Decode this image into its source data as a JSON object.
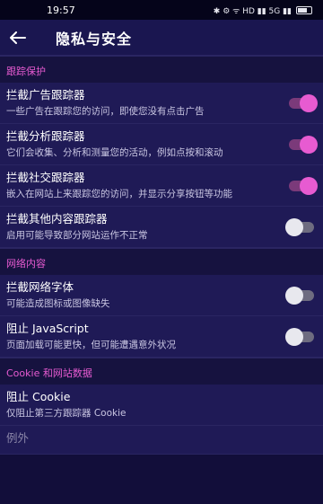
{
  "status": {
    "time": "19:57",
    "icons": "✱ ⚙ ᯤ HD ▮▮ 5G ▮▮"
  },
  "appbar": {
    "title": "隐私与安全"
  },
  "sections": [
    {
      "header": "跟踪保护",
      "rows": [
        {
          "title": "拦截广告跟踪器",
          "desc": "一些广告在跟踪您的访问，即使您没有点击广告",
          "on": true
        },
        {
          "title": "拦截分析跟踪器",
          "desc": "它们会收集、分析和测量您的活动，例如点按和滚动",
          "on": true
        },
        {
          "title": "拦截社交跟踪器",
          "desc": "嵌入在网站上来跟踪您的访问，并显示分享按钮等功能",
          "on": true
        },
        {
          "title": "拦截其他内容跟踪器",
          "desc": "启用可能导致部分网站运作不正常",
          "on": false
        }
      ]
    },
    {
      "header": "网络内容",
      "rows": [
        {
          "title": "拦截网络字体",
          "desc": "可能造成图标或图像缺失",
          "on": false
        },
        {
          "title": "阻止 JavaScript",
          "desc": "页面加载可能更快，但可能遭遇意外状况",
          "on": false
        }
      ]
    },
    {
      "header": "Cookie 和网站数据",
      "rows": [
        {
          "title": "阻止 Cookie",
          "desc": "仅阻止第三方跟踪器 Cookie",
          "on": null
        },
        {
          "title": "例外",
          "desc": "",
          "on": null
        }
      ]
    }
  ]
}
